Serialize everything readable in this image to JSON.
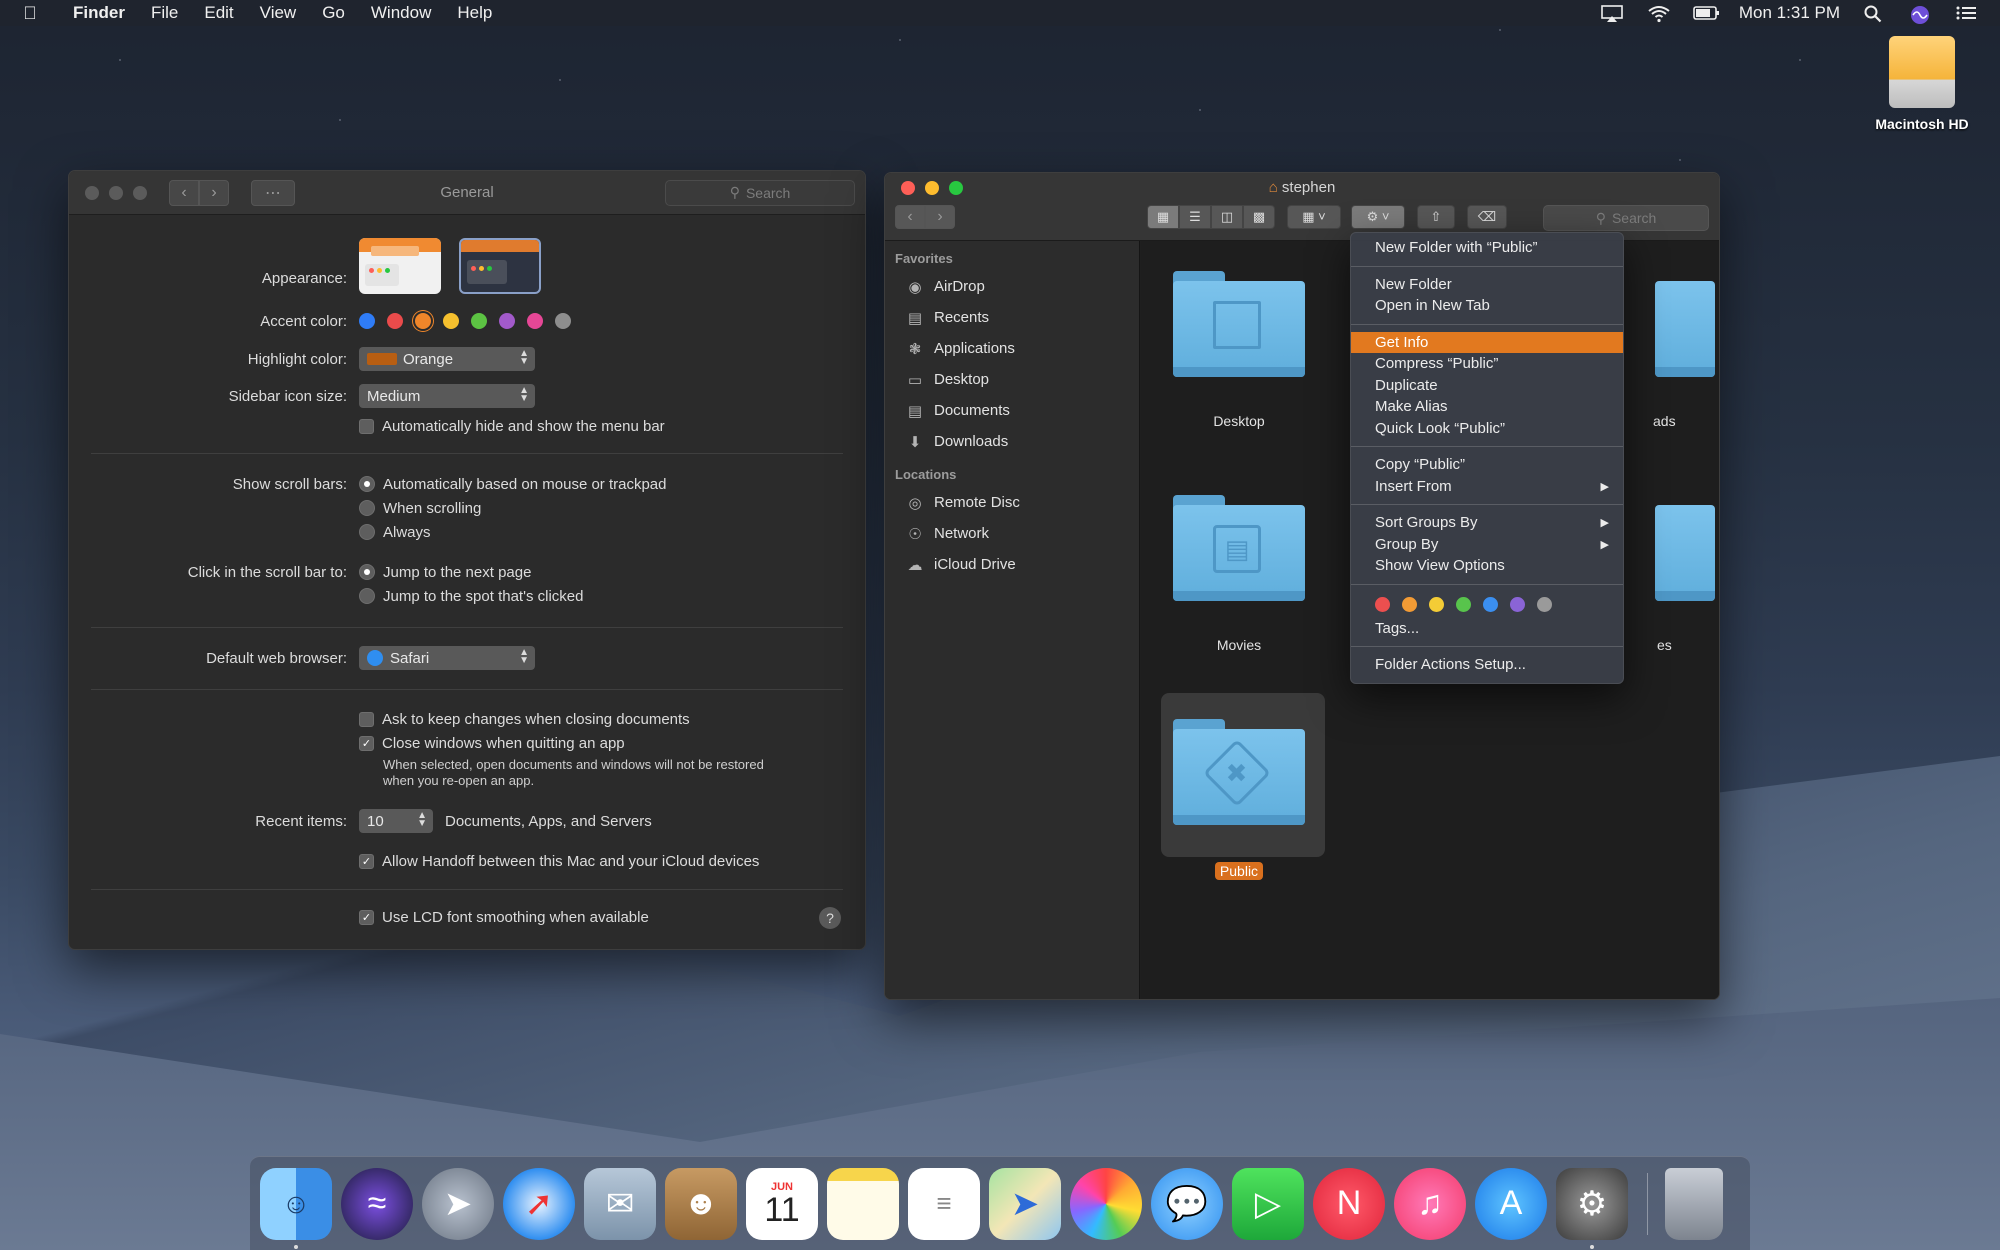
{
  "menubar": {
    "app": "Finder",
    "items": [
      "File",
      "Edit",
      "View",
      "Go",
      "Window",
      "Help"
    ],
    "clock": "Mon 1:31 PM",
    "icons": [
      "airplay-icon",
      "wifi-icon",
      "battery-icon",
      "spotlight-icon",
      "siri-icon",
      "notification-center-icon"
    ]
  },
  "desktop": {
    "icon_label": "Macintosh HD"
  },
  "prefs": {
    "title": "General",
    "search_placeholder": "Search",
    "appearance_label": "Appearance:",
    "accent_label": "Accent color:",
    "accent_colors": [
      "#2f7cf6",
      "#ea4b4b",
      "#f0862a",
      "#f6c02e",
      "#5cc343",
      "#a25aca",
      "#e64796",
      "#8e8e8e"
    ],
    "highlight_label": "Highlight color:",
    "highlight_value": "Orange",
    "highlight_swatch": "#b85e12",
    "sidebar_size_label": "Sidebar icon size:",
    "sidebar_size_value": "Medium",
    "autohide_label": "Automatically hide and show the menu bar",
    "scroll_label": "Show scroll bars:",
    "scroll_options": [
      "Automatically based on mouse or trackpad",
      "When scrolling",
      "Always"
    ],
    "click_label": "Click in the scroll bar to:",
    "click_options": [
      "Jump to the next page",
      "Jump to the spot that's clicked"
    ],
    "browser_label": "Default web browser:",
    "browser_value": "Safari",
    "ask_keep_label": "Ask to keep changes when closing documents",
    "close_windows_label": "Close windows when quitting an app",
    "close_windows_note_1": "When selected, open documents and windows will not be restored",
    "close_windows_note_2": "when you re-open an app.",
    "recent_label": "Recent items:",
    "recent_value": "10",
    "recent_suffix": "Documents, Apps, and Servers",
    "handoff_label": "Allow Handoff between this Mac and your iCloud devices",
    "lcd_label": "Use LCD font smoothing when available",
    "help": "?"
  },
  "finder": {
    "title": "stephen",
    "search_placeholder": "Search",
    "favorites_header": "Favorites",
    "favorites": [
      "AirDrop",
      "Recents",
      "Applications",
      "Desktop",
      "Documents",
      "Downloads"
    ],
    "locations_header": "Locations",
    "locations": [
      "Remote Disc",
      "Network",
      "iCloud Drive"
    ],
    "folders": [
      "Desktop",
      "Movies",
      "Public"
    ],
    "partial_labels": [
      "ads",
      "es"
    ]
  },
  "context_menu": {
    "items_group1": [
      "New Folder with “Public”"
    ],
    "items_group2": [
      "New Folder",
      "Open in New Tab"
    ],
    "items_group3": [
      "Get Info",
      "Compress “Public”",
      "Duplicate",
      "Make Alias",
      "Quick Look “Public”"
    ],
    "items_group4": [
      "Copy “Public”",
      "Insert From"
    ],
    "items_group5": [
      "Sort Groups By",
      "Group By",
      "Show View Options"
    ],
    "tag_colors": [
      "#ec4f4f",
      "#f29b35",
      "#f4cc36",
      "#58c44c",
      "#3b8ff0",
      "#8a64d6",
      "#9a9a9a"
    ],
    "tags_label": "Tags...",
    "folder_actions": "Folder Actions Setup...",
    "highlight_color": "#e2791f"
  },
  "dock": {
    "apps": [
      "finder-icon",
      "siri-icon",
      "launchpad-icon",
      "safari-icon",
      "mail-icon",
      "contacts-icon",
      "calendar-icon",
      "notes-icon",
      "reminders-icon",
      "maps-icon",
      "photos-icon",
      "messages-icon",
      "facetime-icon",
      "news-icon",
      "music-icon",
      "app-store-icon",
      "system-preferences-icon",
      "trash-icon"
    ],
    "calendar_month": "JUN",
    "calendar_day": "11"
  }
}
